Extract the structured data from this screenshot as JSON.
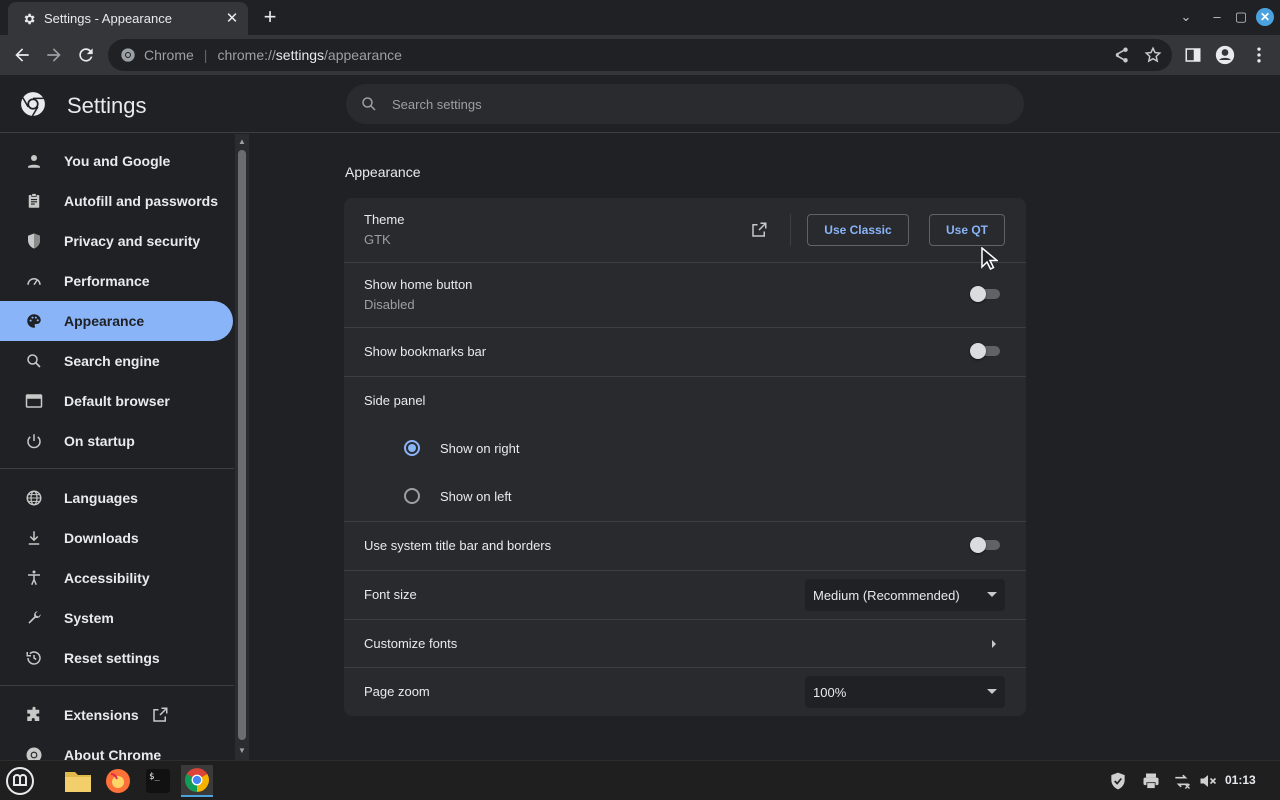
{
  "browser": {
    "tab_title": "Settings - Appearance",
    "omnibox_site": "Chrome",
    "omnibox_url_host": "chrome://",
    "omnibox_url_main": "settings",
    "omnibox_url_path": "/appearance"
  },
  "header": {
    "title": "Settings",
    "search_placeholder": "Search settings"
  },
  "sidebar": {
    "items": [
      {
        "label": "You and Google",
        "icon": "person-icon"
      },
      {
        "label": "Autofill and passwords",
        "icon": "clipboard-icon"
      },
      {
        "label": "Privacy and security",
        "icon": "shield-icon"
      },
      {
        "label": "Performance",
        "icon": "speedometer-icon"
      },
      {
        "label": "Appearance",
        "icon": "palette-icon",
        "active": true
      },
      {
        "label": "Search engine",
        "icon": "search-icon"
      },
      {
        "label": "Default browser",
        "icon": "browser-icon"
      },
      {
        "label": "On startup",
        "icon": "power-icon"
      },
      {
        "label": "Languages",
        "icon": "globe-icon"
      },
      {
        "label": "Downloads",
        "icon": "download-icon"
      },
      {
        "label": "Accessibility",
        "icon": "accessibility-icon"
      },
      {
        "label": "System",
        "icon": "wrench-icon"
      },
      {
        "label": "Reset settings",
        "icon": "history-icon"
      },
      {
        "label": "Extensions",
        "icon": "puzzle-icon"
      },
      {
        "label": "About Chrome",
        "icon": "chrome-icon"
      }
    ]
  },
  "main": {
    "section_title": "Appearance",
    "theme": {
      "label": "Theme",
      "value": "GTK",
      "classic_btn": "Use Classic",
      "qt_btn": "Use QT"
    },
    "home_button": {
      "label": "Show home button",
      "value": "Disabled",
      "enabled": false
    },
    "bookmarks_bar": {
      "label": "Show bookmarks bar",
      "enabled": false
    },
    "side_panel": {
      "label": "Side panel",
      "option_right": "Show on right",
      "option_left": "Show on left",
      "selected": "right"
    },
    "system_title_bar": {
      "label": "Use system title bar and borders",
      "enabled": false
    },
    "font_size": {
      "label": "Font size",
      "value": "Medium (Recommended)"
    },
    "customize_fonts": {
      "label": "Customize fonts"
    },
    "page_zoom": {
      "label": "Page zoom",
      "value": "100%"
    }
  },
  "taskbar": {
    "clock": "01:13",
    "apps": [
      "mint-menu-icon",
      "files-icon",
      "firefox-icon",
      "terminal-icon",
      "chrome-icon"
    ]
  },
  "colors": {
    "accent": "#8ab4f8",
    "background": "#202124",
    "card": "#292a2d"
  }
}
